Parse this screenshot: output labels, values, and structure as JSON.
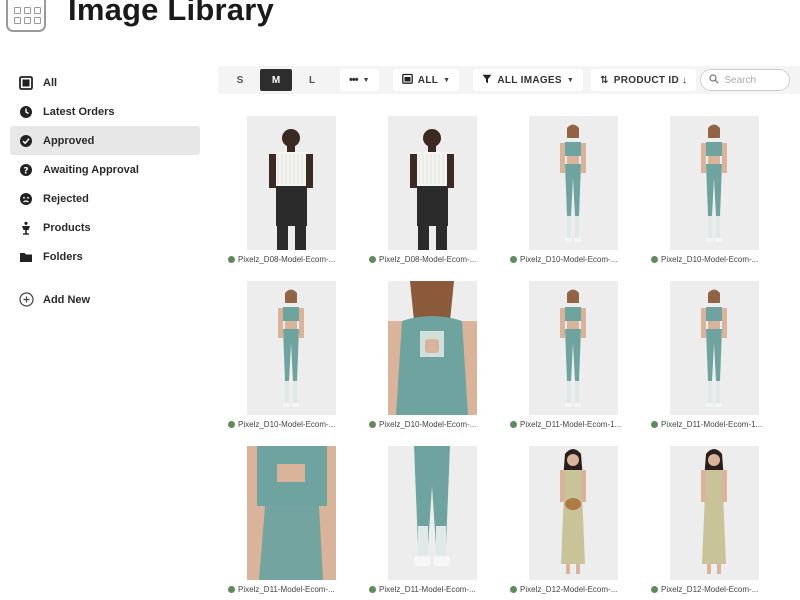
{
  "header": {
    "title": "Image Library"
  },
  "sidebar": {
    "items": [
      {
        "label": "All",
        "icon": "image-icon",
        "active": false
      },
      {
        "label": "Latest Orders",
        "icon": "clock-icon",
        "active": false
      },
      {
        "label": "Approved",
        "icon": "check-circle-icon",
        "active": true
      },
      {
        "label": "Awaiting Approval",
        "icon": "question-circle-icon",
        "active": false
      },
      {
        "label": "Rejected",
        "icon": "sad-face-icon",
        "active": false
      },
      {
        "label": "Products",
        "icon": "mannequin-icon",
        "active": false
      },
      {
        "label": "Folders",
        "icon": "folder-icon",
        "active": false
      }
    ],
    "add_new": "Add New"
  },
  "toolbar": {
    "sizes": [
      "S",
      "M",
      "L"
    ],
    "active_size": "M",
    "more": "•••",
    "filter_all": "ALL",
    "filter_images": "ALL IMAGES",
    "sort": "PRODUCT ID ↓",
    "search_placeholder": "Search"
  },
  "images": [
    {
      "caption": "Pixelz_D08-Model-Ecom-...",
      "subject": "man-back",
      "garment": "white-shirt"
    },
    {
      "caption": "Pixelz_D08-Model-Ecom-...",
      "subject": "man-front",
      "garment": "white-shirt"
    },
    {
      "caption": "Pixelz_D10-Model-Ecom-...",
      "subject": "woman-full",
      "garment": "teal-set"
    },
    {
      "caption": "Pixelz_D10-Model-Ecom-...",
      "subject": "woman-full",
      "garment": "teal-set"
    },
    {
      "caption": "Pixelz_D10-Model-Ecom-...",
      "subject": "woman-back",
      "garment": "teal-set"
    },
    {
      "caption": "Pixelz_D10-Model-Ecom-...",
      "subject": "woman-closeup-back",
      "garment": "teal-set"
    },
    {
      "caption": "Pixelz_D11-Model-Ecom-1...",
      "subject": "woman-full",
      "garment": "teal-set"
    },
    {
      "caption": "Pixelz_D11-Model-Ecom-1...",
      "subject": "woman-full",
      "garment": "teal-set"
    },
    {
      "caption": "Pixelz_D11-Model-Ecom-...",
      "subject": "crop-back",
      "garment": "teal-set"
    },
    {
      "caption": "Pixelz_D11-Model-Ecom-...",
      "subject": "legs",
      "garment": "teal-set"
    },
    {
      "caption": "Pixelz_D12-Model-Ecom-...",
      "subject": "woman-dress-bag",
      "garment": "olive-dress"
    },
    {
      "caption": "Pixelz_D12-Model-Ecom-...",
      "subject": "woman-dress",
      "garment": "olive-dress"
    }
  ],
  "colors": {
    "active_nav": "#e7e7e7",
    "toolbar_bg": "#f4f4f4",
    "approved_dot": "#5d8c5a",
    "teal": "#6fa3a0",
    "olive": "#c9c39a"
  }
}
